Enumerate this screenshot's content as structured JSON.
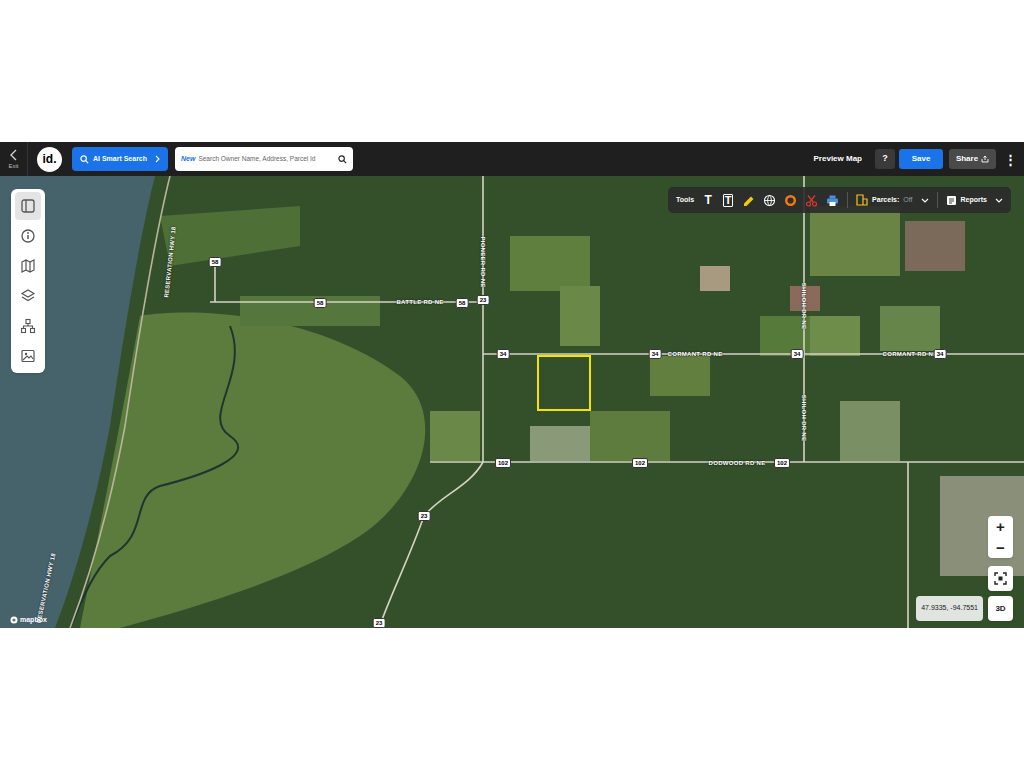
{
  "header": {
    "exit": "Exit",
    "logo": "id.",
    "ai_search": "AI Smart Search",
    "search": {
      "badge": "New",
      "placeholder": "Search Owner Name, Address, Parcel Id"
    },
    "preview": "Preview Map",
    "help": "?",
    "save": "Save",
    "share": "Share",
    "more": "⋮"
  },
  "sidebar": {
    "items": [
      {
        "kind": "layout",
        "selected": true
      },
      {
        "kind": "info",
        "selected": false
      },
      {
        "kind": "map",
        "selected": false
      },
      {
        "kind": "layers",
        "selected": false
      },
      {
        "kind": "hierarchy",
        "selected": false
      },
      {
        "kind": "image",
        "selected": false
      }
    ]
  },
  "toolbar": {
    "label": "Tools",
    "tools": [
      {
        "kind": "text",
        "glyph": "T",
        "color": "#ffffff"
      },
      {
        "kind": "textbox",
        "glyph": "T",
        "color": "#ffffff"
      },
      {
        "kind": "pencil",
        "color": "#f5c518"
      },
      {
        "kind": "pin",
        "color": "#ffffff"
      },
      {
        "kind": "circle",
        "color": "#f07a1a"
      },
      {
        "kind": "scissors",
        "color": "#e0392b"
      },
      {
        "kind": "printer",
        "color": "#4a90e2"
      }
    ],
    "parcels": {
      "label": "Parcels:",
      "state": "Off",
      "on": false
    },
    "reports": "Reports"
  },
  "map": {
    "road_labels": [
      "BATTLE RD NE",
      "PIONEER RD NE",
      "CORMANT RD NE",
      "CORMANT RD NE",
      "SHILOH DR NE",
      "SHILOH DR NE",
      "DODWOOD RD NE",
      "RESERVATION HWY 18",
      "RESERVATION HWY 18"
    ],
    "shields": [
      "58",
      "58",
      "58",
      "23",
      "34",
      "34",
      "34",
      "34",
      "102",
      "102",
      "102",
      "23",
      "23"
    ],
    "coordinates": "47.9335, -94.7551",
    "zoom_in": "+",
    "zoom_out": "−",
    "view_3d": "3D",
    "attribution": "mapbox"
  }
}
